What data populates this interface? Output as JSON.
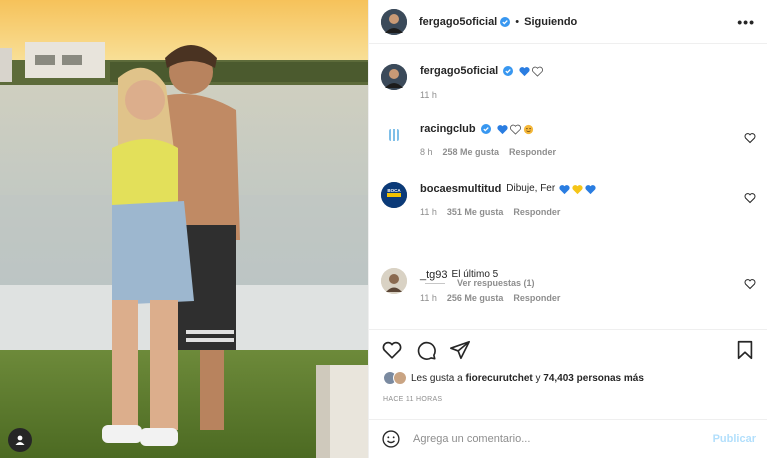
{
  "post": {
    "username": "fergago5oficial",
    "separator": "•",
    "follow_status": "Siguiendo",
    "more": "•••"
  },
  "comments": [
    {
      "user": "fergago5oficial",
      "text": "",
      "emojis": [
        "blue-heart",
        "white-heart"
      ],
      "time": "11 h",
      "likes": "",
      "reply": ""
    },
    {
      "user": "racingclub",
      "text": "",
      "emojis": [
        "blue-heart",
        "white-heart",
        "hugging-face"
      ],
      "time": "8 h",
      "likes": "258 Me gusta",
      "reply": "Responder"
    },
    {
      "user": "bocaesmultitud",
      "text": "Dibuje, Fer",
      "emojis": [
        "blue-heart",
        "yellow-heart",
        "blue-heart"
      ],
      "time": "11 h",
      "likes": "351 Me gusta",
      "reply": "Responder"
    },
    {
      "user": "_tg93",
      "text": "El último 5",
      "emojis": [],
      "time": "11 h",
      "likes": "256 Me gusta",
      "reply": "Responder"
    }
  ],
  "view_replies": "Ver respuestas (1)",
  "likes_line": {
    "prefix": "Les gusta a ",
    "user": "fiorecurutchet",
    "middle": " y ",
    "count": "74,403 personas más"
  },
  "time_ago": "HACE 11 HORAS",
  "comment_box": {
    "placeholder": "Agrega un comentario...",
    "publish": "Publicar"
  },
  "colors": {
    "verified": "#3897f0",
    "link_disabled": "#b2dffc",
    "muted": "#8e8e8e"
  },
  "icons": [
    "verified-badge-icon",
    "heart-icon",
    "comment-icon",
    "share-icon",
    "bookmark-icon",
    "smiley-icon",
    "user-tag-icon"
  ]
}
